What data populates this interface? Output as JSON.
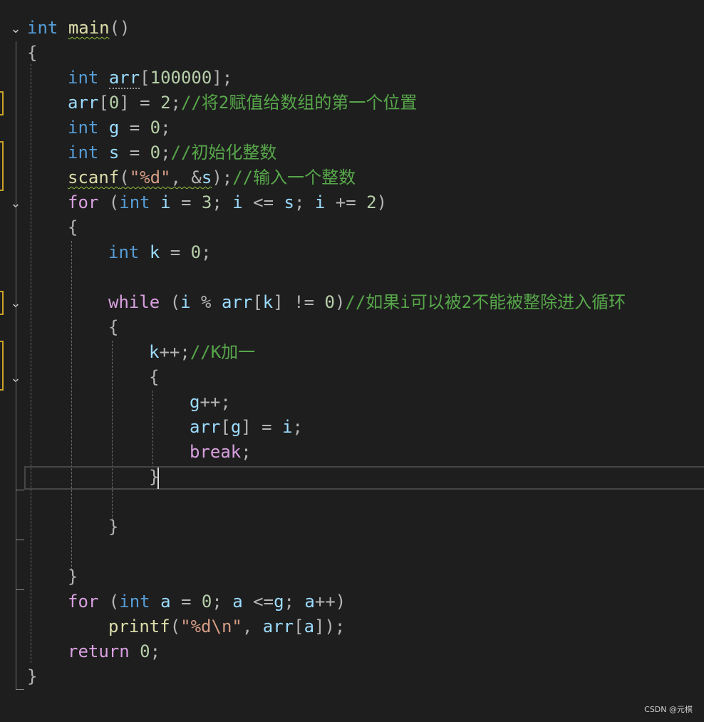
{
  "colors": {
    "background": "#1e1e1e",
    "keyword": "#569cd6",
    "control_keyword": "#d8a0df",
    "function": "#dcdcaa",
    "variable": "#9cdcfe",
    "number": "#b5cea8",
    "string": "#d69d85",
    "comment": "#57a64a",
    "operator": "#b4b4b4",
    "change_marker": "#c9a227"
  },
  "icons": {
    "fold": "chevron-down-icon"
  },
  "code": {
    "main_kw": "int",
    "main_name": "main",
    "main_parens": "()",
    "open_main": "{",
    "arr_kw": "int",
    "arr_name": "arr",
    "arr_open": "[",
    "arr_size": "100000",
    "arr_close": "];",
    "arr0_name": "arr",
    "arr0_open": "[",
    "arr0_idx": "0",
    "arr0_close": "]",
    "arr0_eq": " = ",
    "arr0_val": "2",
    "arr0_semi": ";",
    "arr0_comment": "//将2赋值给数组的第一个位置",
    "g_kw": "int",
    "g_name": "g",
    "g_eq": " = ",
    "g_val": "0",
    "g_semi": ";",
    "s_kw": "int",
    "s_name": "s",
    "s_eq": " = ",
    "s_val": "0",
    "s_semi": ";",
    "s_comment": "//初始化整数",
    "scanf_name": "scanf",
    "scanf_open": "(",
    "scanf_fmt": "\"%d\"",
    "scanf_comma": ", ",
    "scanf_amp": "&",
    "scanf_var": "s",
    "scanf_close": ");",
    "scanf_comment": "//输入一个整数",
    "for1_kw": "for",
    "for1_open": " (",
    "for1_int": "int",
    "for1_i1": "i",
    "for1_eq": " = ",
    "for1_3": "3",
    "for1_semi1": "; ",
    "for1_i2": "i",
    "for1_le": " <= ",
    "for1_s": "s",
    "for1_semi2": "; ",
    "for1_i3": "i",
    "for1_pe": " += ",
    "for1_2": "2",
    "for1_close": ")",
    "open_for1": "{",
    "k_kw": "int",
    "k_name": "k",
    "k_eq": " = ",
    "k_val": "0",
    "k_semi": ";",
    "while_kw": "while",
    "while_open": " (",
    "while_i": "i",
    "while_mod": " % ",
    "while_arr": "arr",
    "while_bo": "[",
    "while_k": "k",
    "while_bc": "]",
    "while_ne": " != ",
    "while_0": "0",
    "while_close": ")",
    "while_comment": "//如果i可以被2不能被整除进入循环",
    "open_while": "{",
    "kpp_name": "k",
    "kpp_op": "++;",
    "kpp_comment": "//K加一",
    "open_block": "{",
    "gpp_name": "g",
    "gpp_op": "++;",
    "assign_arr": "arr",
    "assign_bo": "[",
    "assign_g": "g",
    "assign_bc": "]",
    "assign_eq": " = ",
    "assign_i": "i",
    "assign_semi": ";",
    "break_kw": "break",
    "break_semi": ";",
    "close_block": "}",
    "close_while": "}",
    "close_for1": "}",
    "for2_kw": "for",
    "for2_open": " (",
    "for2_int": "int",
    "for2_a1": "a",
    "for2_eq": " = ",
    "for2_0": "0",
    "for2_semi1": "; ",
    "for2_a2": "a",
    "for2_le": " <=",
    "for2_g": "g",
    "for2_semi2": "; ",
    "for2_a3": "a",
    "for2_pp": "++",
    "for2_close": ")",
    "printf_name": "printf",
    "printf_open": "(",
    "printf_fmt": "\"%d\\n\"",
    "printf_comma": ", ",
    "printf_arr": "arr",
    "printf_bo": "[",
    "printf_a": "a",
    "printf_bc": "]",
    "printf_close": ");",
    "return_kw": "return",
    "return_sp": " ",
    "return_val": "0",
    "return_semi": ";",
    "close_main": "}"
  },
  "watermark": "CSDN @元棋"
}
